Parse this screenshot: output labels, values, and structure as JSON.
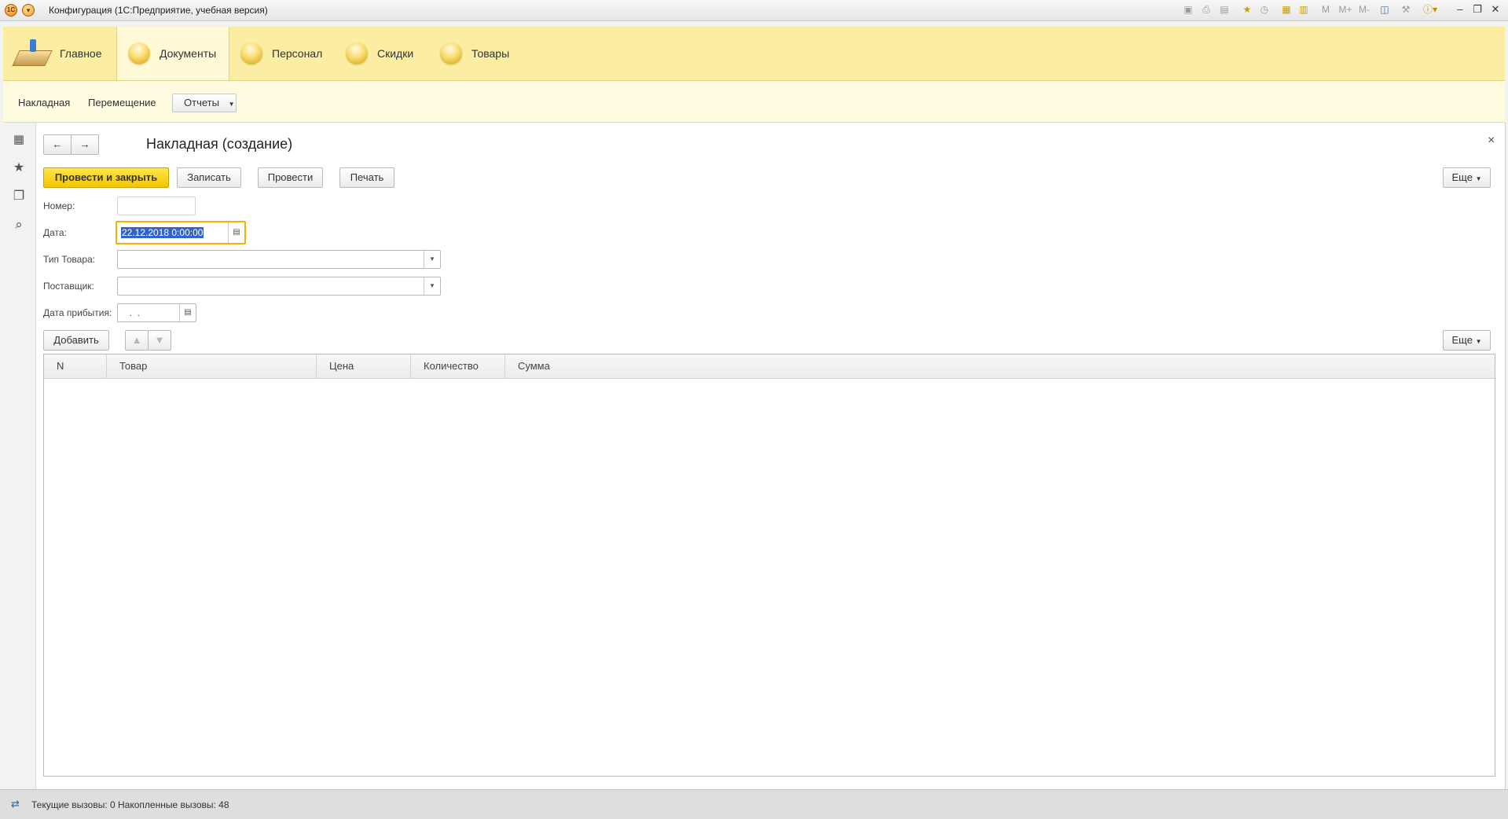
{
  "window": {
    "title": "Конфигурация  (1С:Предприятие, учебная версия)",
    "app_icon_text": "1С",
    "toolbar_text_icons": [
      "M",
      "M+",
      "M-"
    ]
  },
  "sections": [
    {
      "label": "Главное",
      "icon": "home-icon"
    },
    {
      "label": "Документы",
      "icon": "section-ball-icon",
      "active": true
    },
    {
      "label": "Персонал",
      "icon": "section-ball-icon"
    },
    {
      "label": "Скидки",
      "icon": "section-ball-icon"
    },
    {
      "label": "Товары",
      "icon": "section-ball-icon"
    }
  ],
  "submenu": {
    "items": [
      "Накладная",
      "Перемещение"
    ],
    "reports_label": "Отчеты"
  },
  "form": {
    "title": "Накладная (создание)",
    "close_glyph": "×",
    "buttons": {
      "post_and_close": "Провести и закрыть",
      "save": "Записать",
      "post": "Провести",
      "print": "Печать",
      "more": "Еще"
    },
    "fields": {
      "number_label": "Номер:",
      "number_value": "",
      "date_label": "Дата:",
      "date_value": "22.12.2018  0:00:00",
      "product_type_label": "Тип Товара:",
      "product_type_value": "",
      "supplier_label": "Поставщик:",
      "supplier_value": "",
      "arrival_label": "Дата прибытия:",
      "arrival_value": "  .  ."
    },
    "table_toolbar": {
      "add_label": "Добавить",
      "more_label": "Еще"
    },
    "table": {
      "columns": [
        "N",
        "Товар",
        "Цена",
        "Количество",
        "Сумма"
      ],
      "rows": []
    }
  },
  "statusbar": {
    "text": "Текущие вызовы: 0   Накопленные вызовы: 48"
  },
  "colors": {
    "sections_bg": "#fbeea3",
    "submenu_bg": "#fffbe0",
    "primary_button": "#f5c500",
    "focus_border": "#f0b400",
    "selection": "#3264c8"
  }
}
